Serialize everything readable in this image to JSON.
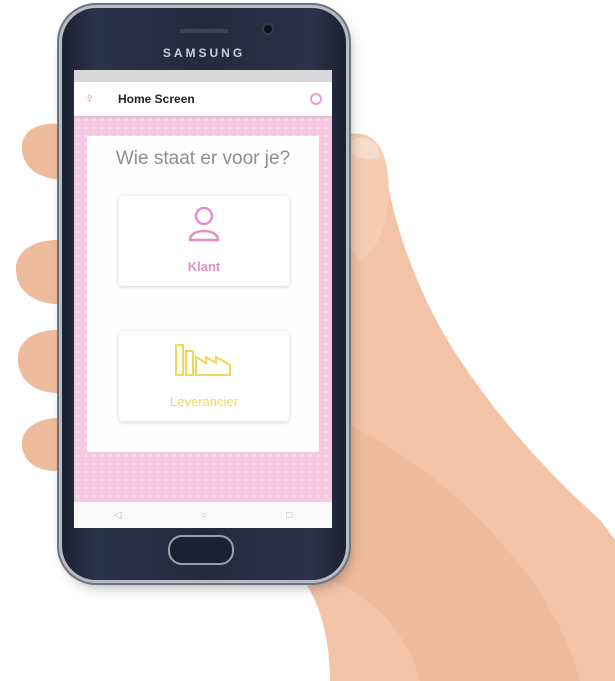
{
  "device": {
    "brand": "SAMSUNG"
  },
  "status_bar": {
    "left": "",
    "right": ""
  },
  "app_bar": {
    "title": "Home Screen"
  },
  "main": {
    "question": "Wie staat er voor je?",
    "options": [
      {
        "label": "Klant",
        "icon": "person-icon",
        "color": "#e58fc6"
      },
      {
        "label": "Leverancier",
        "icon": "factory-icon",
        "color": "#f2d75b"
      }
    ]
  },
  "nav_bar": {
    "items": [
      "back-icon",
      "home-icon",
      "recents-icon"
    ]
  },
  "colors": {
    "accent_pink": "#e58fc6",
    "accent_yellow": "#f2d75b",
    "background_pattern": "#f6c9e2"
  }
}
